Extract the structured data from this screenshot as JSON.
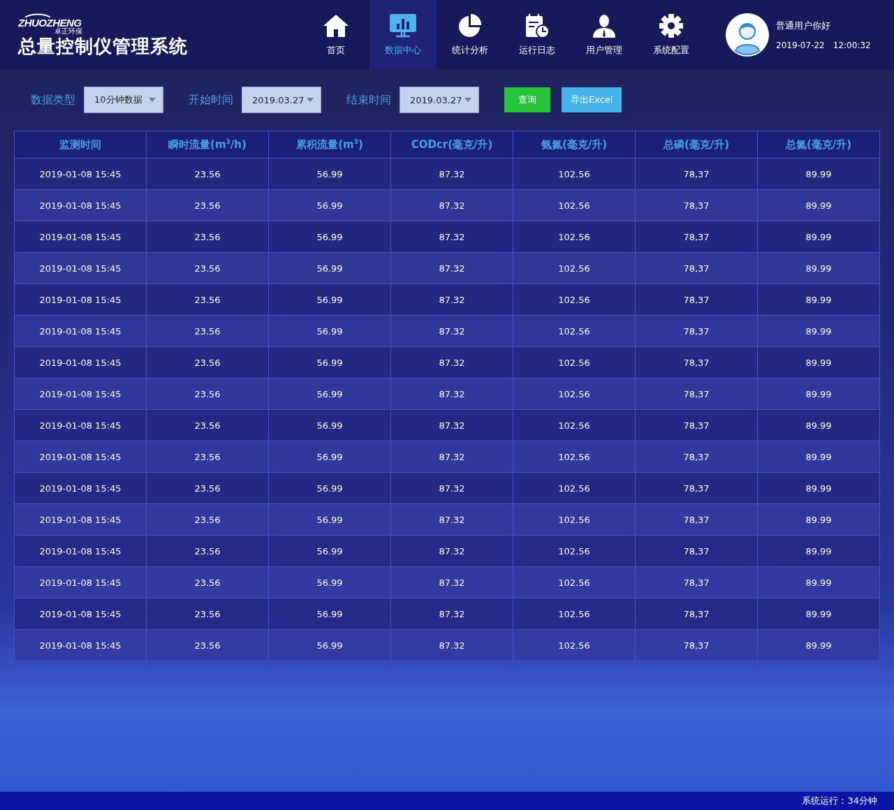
{
  "logo": {
    "brand": "ZHUOZHENG",
    "brand_sub": "卓正环保",
    "title": "总量控制仪管理系统"
  },
  "nav": [
    {
      "label": "首页",
      "kind": "home",
      "selected": false
    },
    {
      "label": "数据中心",
      "kind": "monitor",
      "selected": true
    },
    {
      "label": "统计分析",
      "kind": "pie",
      "selected": false
    },
    {
      "label": "运行日志",
      "kind": "calendar",
      "selected": false
    },
    {
      "label": "用户管理",
      "kind": "user",
      "selected": false
    },
    {
      "label": "系统配置",
      "kind": "gear",
      "selected": false
    }
  ],
  "user": {
    "greeting": "普通用户你好",
    "date": "2019-07-22",
    "time": "12:00:32"
  },
  "filters": [
    {
      "label": "数据类型",
      "value": "10分钟数据"
    },
    {
      "label": "开始时间",
      "value": "2019.03.27"
    },
    {
      "label": "结束时间",
      "value": "2019.03.27"
    }
  ],
  "buttons": [
    {
      "label": "查询",
      "kind": "query"
    },
    {
      "label": "导出Excel",
      "kind": "export"
    }
  ],
  "table": {
    "columns": [
      "监测时间",
      "瞬时流量(m$^{3}$/h)",
      "累积流量(m$^{3}$)",
      "CODcr(毫克/升)",
      "氨氮(毫克/升)",
      "总磷(毫克/升)",
      "总氮(毫克/升)"
    ],
    "rows": [
      [
        "2019-01-08 15:45",
        "23.56",
        "56.99",
        "87.32",
        "102.56",
        "78,37",
        "89.99"
      ],
      [
        "2019-01-08 15:45",
        "23.56",
        "56.99",
        "87.32",
        "102.56",
        "78,37",
        "89.99"
      ],
      [
        "2019-01-08 15:45",
        "23.56",
        "56.99",
        "87.32",
        "102.56",
        "78,37",
        "89.99"
      ],
      [
        "2019-01-08 15:45",
        "23.56",
        "56.99",
        "87.32",
        "102.56",
        "78,37",
        "89.99"
      ],
      [
        "2019-01-08 15:45",
        "23.56",
        "56.99",
        "87.32",
        "102.56",
        "78,37",
        "89.99"
      ],
      [
        "2019-01-08 15:45",
        "23.56",
        "56.99",
        "87.32",
        "102.56",
        "78,37",
        "89.99"
      ],
      [
        "2019-01-08 15:45",
        "23.56",
        "56.99",
        "87.32",
        "102.56",
        "78,37",
        "89.99"
      ],
      [
        "2019-01-08 15:45",
        "23.56",
        "56.99",
        "87.32",
        "102.56",
        "78,37",
        "89.99"
      ],
      [
        "2019-01-08 15:45",
        "23.56",
        "56.99",
        "87.32",
        "102.56",
        "78,37",
        "89.99"
      ],
      [
        "2019-01-08 15:45",
        "23.56",
        "56.99",
        "87.32",
        "102.56",
        "78,37",
        "89.99"
      ],
      [
        "2019-01-08 15:45",
        "23.56",
        "56.99",
        "87.32",
        "102.56",
        "78,37",
        "89.99"
      ],
      [
        "2019-01-08 15:45",
        "23.56",
        "56.99",
        "87.32",
        "102.56",
        "78,37",
        "89.99"
      ],
      [
        "2019-01-08 15:45",
        "23.56",
        "56.99",
        "87.32",
        "102.56",
        "78,37",
        "89.99"
      ],
      [
        "2019-01-08 15:45",
        "23.56",
        "56.99",
        "87.32",
        "102.56",
        "78,37",
        "89.99"
      ],
      [
        "2019-01-08 15:45",
        "23.56",
        "56.99",
        "87.32",
        "102.56",
        "78,37",
        "89.99"
      ],
      [
        "2019-01-08 15:45",
        "23.56",
        "56.99",
        "87.32",
        "102.56",
        "78,37",
        "89.99"
      ]
    ]
  },
  "status_bar": {
    "text": "系统运行：34分钟"
  }
}
